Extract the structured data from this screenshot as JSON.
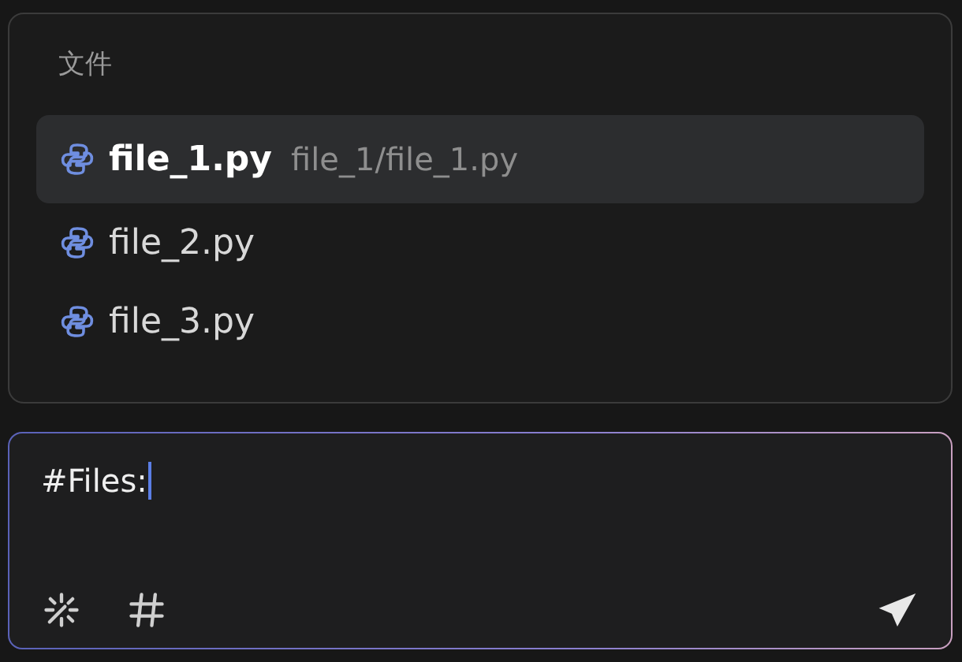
{
  "files_panel": {
    "heading": "文件",
    "items": [
      {
        "name": "file_1.py",
        "path": "file_1/file_1.py",
        "selected": true
      },
      {
        "name": "file_2.py",
        "selected": false
      },
      {
        "name": "file_3.py",
        "selected": false
      }
    ]
  },
  "input": {
    "value": "#Files:"
  }
}
